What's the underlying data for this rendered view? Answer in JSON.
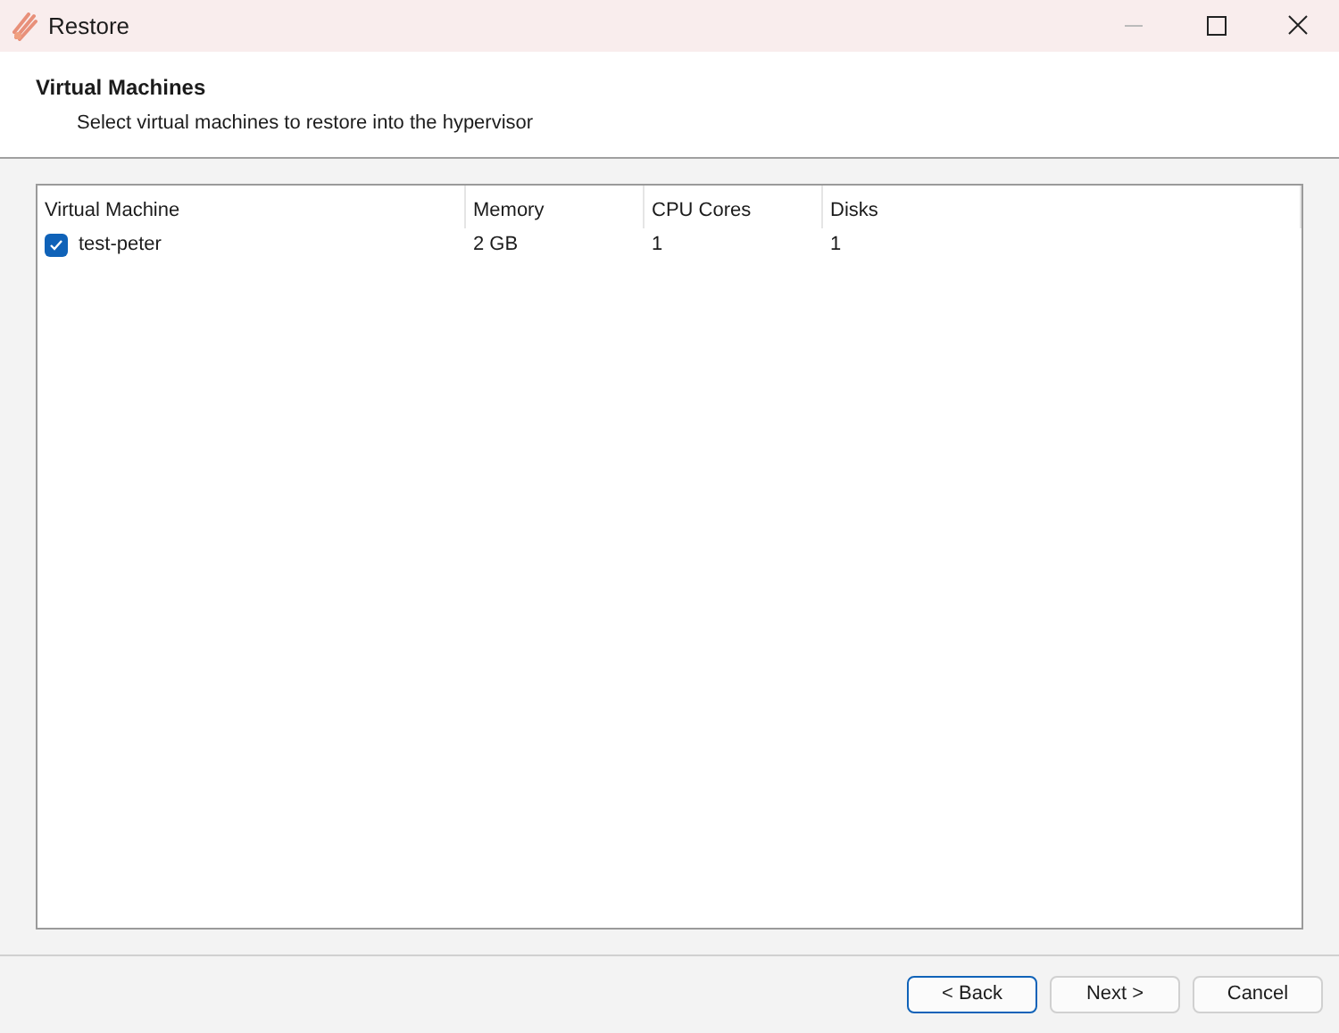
{
  "window": {
    "title": "Restore"
  },
  "header": {
    "title": "Virtual Machines",
    "subtitle": "Select virtual machines to restore into the hypervisor"
  },
  "table": {
    "columns": [
      "Virtual Machine",
      "Memory",
      "CPU Cores",
      "Disks"
    ],
    "rows": [
      {
        "checked": true,
        "cells": [
          "test-peter",
          "2 GB",
          "1",
          "1"
        ]
      }
    ]
  },
  "buttons": [
    {
      "label": "< Back",
      "focused": true
    },
    {
      "label": "Next >",
      "focused": false
    },
    {
      "label": "Cancel",
      "focused": false
    }
  ]
}
